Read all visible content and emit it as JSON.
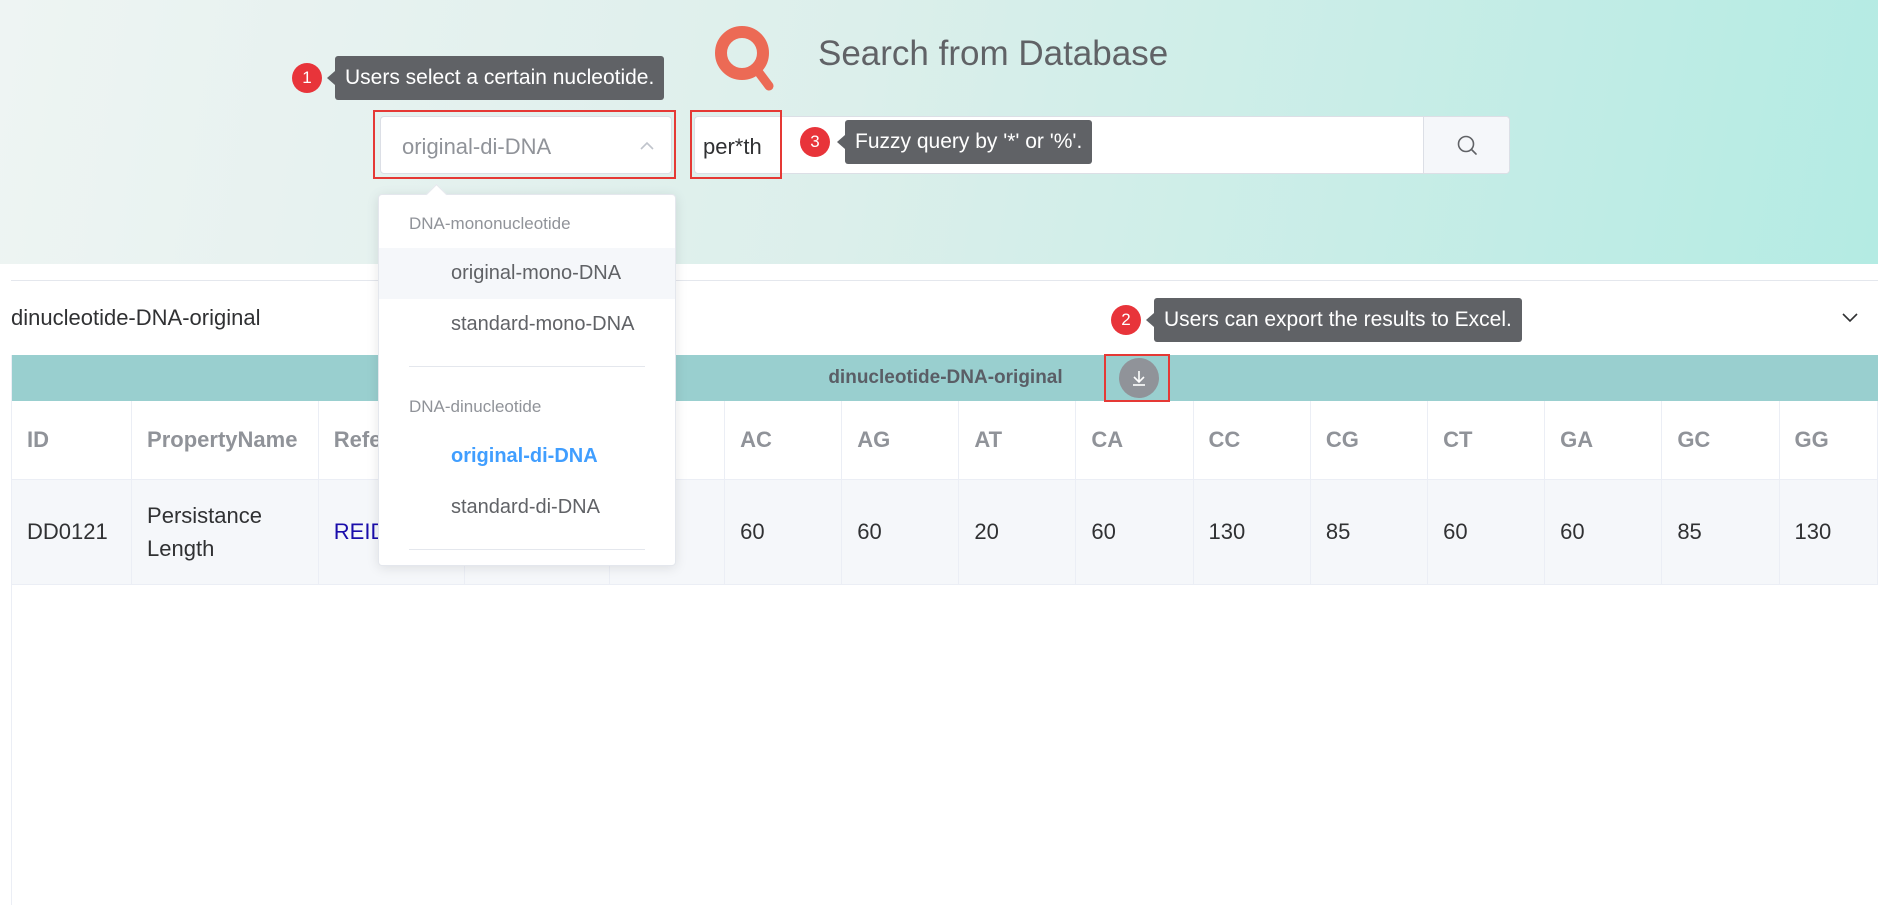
{
  "header": {
    "title": "Search from Database",
    "logo_icon": "magnifier-logo-icon"
  },
  "search": {
    "select_value": "original-di-DNA",
    "query_value": "per*th",
    "search_icon": "search-icon"
  },
  "dropdown": {
    "groups": [
      {
        "label": "DNA-mononucleotide",
        "options": [
          "original-mono-DNA",
          "standard-mono-DNA"
        ]
      },
      {
        "label": "DNA-dinucleotide",
        "options": [
          "original-di-DNA",
          "standard-di-DNA"
        ]
      }
    ],
    "selected": "original-di-DNA",
    "hovered": "original-mono-DNA"
  },
  "annotations": [
    {
      "number": "1",
      "text": "Users select a certain nucleotide."
    },
    {
      "number": "2",
      "text": "Users can export the results to Excel."
    },
    {
      "number": "3",
      "text": "Fuzzy query by '*' or '%'."
    }
  ],
  "results": {
    "collapse_title": "dinucleotide-DNA-original",
    "table_caption": "dinucleotide-DNA-original",
    "columns": [
      "ID",
      "PropertyName",
      "Refe",
      "",
      "",
      "AC",
      "AG",
      "AT",
      "CA",
      "CC",
      "CG",
      "CT",
      "GA",
      "GC",
      "GG"
    ],
    "rows": [
      {
        "cells": [
          "DD0121",
          "Persistance Length",
          "REID",
          "",
          "",
          "60",
          "60",
          "20",
          "60",
          "130",
          "85",
          "60",
          "60",
          "85",
          "130"
        ]
      }
    ]
  },
  "colors": {
    "accent": "#409eff",
    "highlight": "#e53935",
    "caption_bg": "#99cfcf",
    "badge": "#e8343a",
    "tooltip_bg": "#606266"
  }
}
